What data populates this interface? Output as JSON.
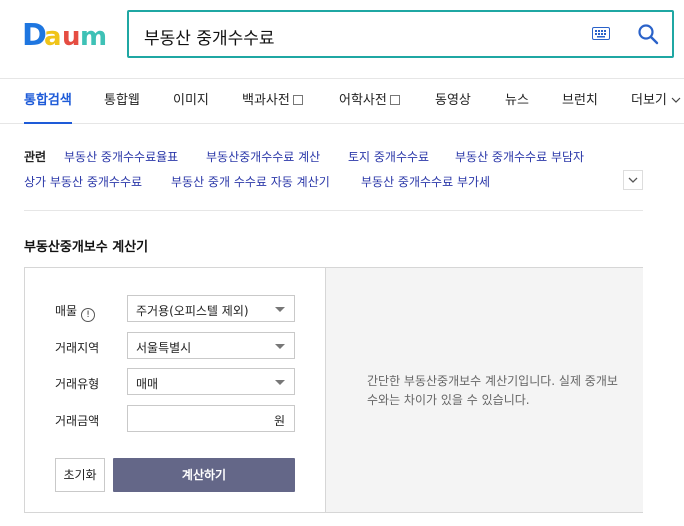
{
  "brand": {
    "logo_letters": [
      "D",
      "a",
      "u",
      "m"
    ],
    "colors": {
      "d": "#1e76e0",
      "a": "#f0c419",
      "u": "#e54d42",
      "m": "#3ec1b6"
    }
  },
  "search": {
    "query": "부동산 중개수수료",
    "keyboard_icon": "keyboard-icon",
    "search_icon": "search-icon"
  },
  "tabs": {
    "items": [
      {
        "label": "통합검색",
        "active": true
      },
      {
        "label": "통합웹",
        "active": false
      },
      {
        "label": "이미지",
        "active": false
      },
      {
        "label": "백과사전",
        "active": false
      },
      {
        "label": "어학사전",
        "active": false
      },
      {
        "label": "동영상",
        "active": false
      },
      {
        "label": "뉴스",
        "active": false
      },
      {
        "label": "브런치",
        "active": false
      },
      {
        "label": "더보기",
        "active": false
      }
    ]
  },
  "related": {
    "label": "관련",
    "links": [
      "부동산 중개수수료율표",
      "부동산중개수수료 계산",
      "토지 중개수수료",
      "부동산 중개수수료 부담자",
      "상가 부동산 중개수수료",
      "부동산 중개 수수료 자동 계산기",
      "부동산 중개수수료 부가세"
    ]
  },
  "calculator": {
    "title": "부동산중개보수 계산기",
    "rows": {
      "property_label": "매물",
      "region_label": "거래지역",
      "type_label": "거래유형",
      "amount_label": "거래금액"
    },
    "property_value": "주거용(오피스텔 제외)",
    "region_value": "서울특별시",
    "type_value": "매매",
    "amount_value": "",
    "amount_unit": "원",
    "reset_label": "초기화",
    "calc_label": "계산하기",
    "description": "간단한 부동산중개보수 계산기입니다. 실제 중개보수와는 차이가 있을 수 있습니다.",
    "info_glyph": "!"
  }
}
